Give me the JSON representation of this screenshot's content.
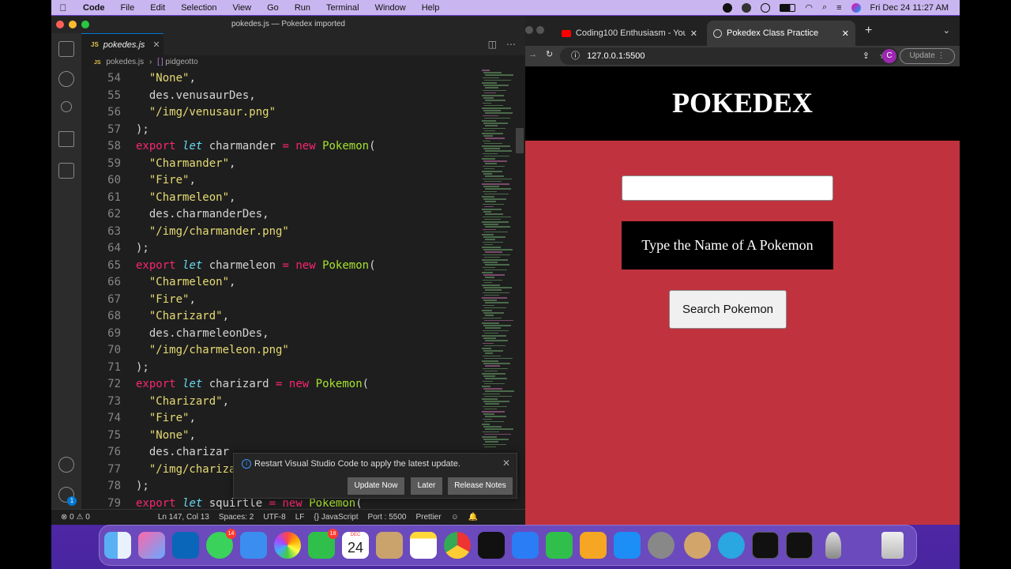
{
  "menubar": {
    "app": "Code",
    "items": [
      "File",
      "Edit",
      "Selection",
      "View",
      "Go",
      "Run",
      "Terminal",
      "Window",
      "Help"
    ],
    "clock": "Fri Dec 24  11:27 AM"
  },
  "vscode": {
    "title": "pokedes.js — Pokedex imported",
    "tab_label": "pokedes.js",
    "tab_js": "JS",
    "breadcrumb_file": "pokedes.js",
    "breadcrumb_symbol": "pidgeotto",
    "lines": [
      {
        "n": "54",
        "t": "  \"None\","
      },
      {
        "n": "55",
        "t": "  des.venusaurDes,"
      },
      {
        "n": "56",
        "t": "  \"/img/venusaur.png\""
      },
      {
        "n": "57",
        "t": ");"
      },
      {
        "n": "58",
        "t": "export let charmander = new Pokemon("
      },
      {
        "n": "59",
        "t": "  \"Charmander\","
      },
      {
        "n": "60",
        "t": "  \"Fire\","
      },
      {
        "n": "61",
        "t": "  \"Charmeleon\","
      },
      {
        "n": "62",
        "t": "  des.charmanderDes,"
      },
      {
        "n": "63",
        "t": "  \"/img/charmander.png\""
      },
      {
        "n": "64",
        "t": ");"
      },
      {
        "n": "65",
        "t": "export let charmeleon = new Pokemon("
      },
      {
        "n": "66",
        "t": "  \"Charmeleon\","
      },
      {
        "n": "67",
        "t": "  \"Fire\","
      },
      {
        "n": "68",
        "t": "  \"Charizard\","
      },
      {
        "n": "69",
        "t": "  des.charmeleonDes,"
      },
      {
        "n": "70",
        "t": "  \"/img/charmeleon.png\""
      },
      {
        "n": "71",
        "t": ");"
      },
      {
        "n": "72",
        "t": "export let charizard = new Pokemon("
      },
      {
        "n": "73",
        "t": "  \"Charizard\","
      },
      {
        "n": "74",
        "t": "  \"Fire\","
      },
      {
        "n": "75",
        "t": "  \"None\","
      },
      {
        "n": "76",
        "t": "  des.charizar"
      },
      {
        "n": "77",
        "t": "  \"/img/chariza"
      },
      {
        "n": "78",
        "t": ");"
      },
      {
        "n": "79",
        "t": "export let squirtle = new Pokemon("
      }
    ],
    "status": {
      "problems": "⊗ 0 ⚠ 0",
      "position": "Ln 147, Col 13",
      "spaces": "Spaces: 2",
      "encoding": "UTF-8",
      "eol": "LF",
      "language": "{} JavaScript",
      "port": "Port : 5500",
      "formatter": "Prettier"
    },
    "notification": {
      "message": "Restart Visual Studio Code to apply the latest update.",
      "update_now": "Update Now",
      "later": "Later",
      "release_notes": "Release Notes"
    }
  },
  "chrome": {
    "tab1_label": "Coding100 Enthusiasm - YouTu",
    "tab2_label": "Pokedex Class Practice",
    "url": "127.0.0.1:5500",
    "update_label": "Update",
    "profile_initial": "C"
  },
  "page": {
    "heading": "POKEDEX",
    "prompt": "Type the Name of A Pokemon",
    "search_button": "Search Pokemon",
    "search_value": ""
  },
  "dock": {
    "messages_badge": "14",
    "facetime_badge": "18",
    "calendar_month": "DEC",
    "calendar_day": "24",
    "settings_badge": "1"
  }
}
